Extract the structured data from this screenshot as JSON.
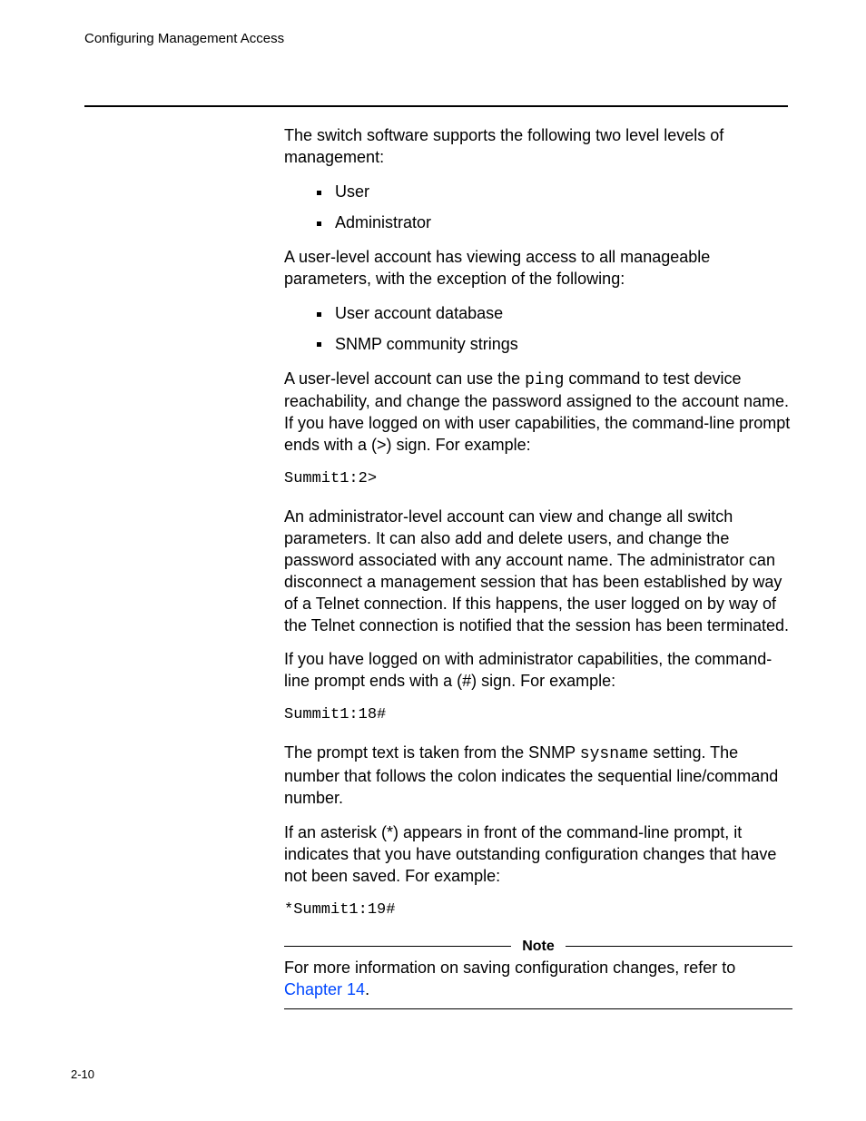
{
  "running_head": "Configuring Management Access",
  "p_intro": "The switch software supports the following two level levels of management:",
  "levels": [
    "User",
    "Administrator"
  ],
  "p_user_intro": "A user-level account has viewing access to all manageable parameters, with the exception of the following:",
  "user_exceptions": [
    "User account database",
    "SNMP community strings"
  ],
  "p_user_ping_a": "A user-level account can use the ",
  "ping_cmd": "ping",
  "p_user_ping_b": " command to test device reachability, and change the password assigned to the account name. If you have logged on with user capabilities, the command-line prompt ends with a (>) sign. For example:",
  "code_user": "Summit1:2>",
  "p_admin": "An administrator-level account can view and change all switch parameters. It can also add and delete users, and change the password associated with any account name. The administrator can disconnect a management session that has been established by way of a Telnet connection. If this happens, the user logged on by way of the Telnet connection is notified that the session has been terminated.",
  "p_admin_prompt": "If you have logged on with administrator capabilities, the command-line prompt ends with a (#) sign. For example:",
  "code_admin": "Summit1:18#",
  "p_snmp_a": "The prompt text is taken from the SNMP ",
  "sysname": "sysname",
  "p_snmp_b": " setting. The number that follows the colon indicates the sequential line/command number.",
  "p_asterisk": "If an asterisk (*) appears in front of the command-line prompt, it indicates that you have outstanding configuration changes that have not been saved. For example:",
  "code_asterisk": "*Summit1:19#",
  "note_label": "Note",
  "note_text_a": "For more information on saving configuration changes, refer to ",
  "note_link": "Chapter 14",
  "note_text_b": ".",
  "page_number": "2-10"
}
